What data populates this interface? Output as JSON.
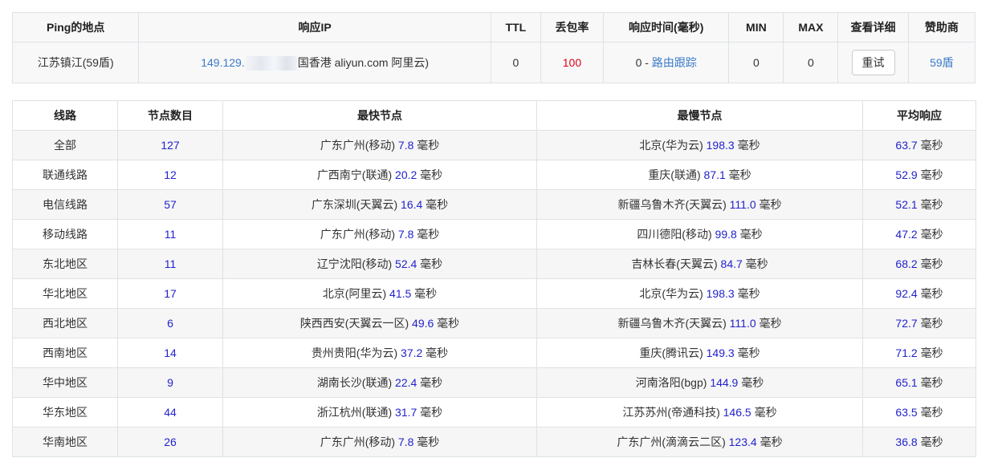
{
  "top_table": {
    "headers": [
      "Ping的地点",
      "响应IP",
      "TTL",
      "丢包率",
      "响应时间(毫秒)",
      "MIN",
      "MAX",
      "查看详细",
      "赞助商"
    ],
    "row": {
      "location": "江苏镇江(59盾)",
      "ip_prefix": "149.129.",
      "ip_suffix": "国香港 aliyun.com 阿里云)",
      "ttl": "0",
      "loss": "100",
      "resp_time": "0",
      "resp_sep": " - ",
      "trace_link": "路由跟踪",
      "min": "0",
      "max": "0",
      "retry_button": "重试",
      "sponsor": "59盾"
    }
  },
  "bottom_table": {
    "headers": [
      "线路",
      "节点数目",
      "最快节点",
      "最慢节点",
      "平均响应"
    ],
    "unit": "毫秒",
    "rows": [
      {
        "line": "全部",
        "count": "127",
        "fast_name": "广东广州(移动)",
        "fast_val": "7.8",
        "slow_name": "北京(华为云)",
        "slow_val": "198.3",
        "avg": "63.7"
      },
      {
        "line": "联通线路",
        "count": "12",
        "fast_name": "广西南宁(联通)",
        "fast_val": "20.2",
        "slow_name": "重庆(联通)",
        "slow_val": "87.1",
        "avg": "52.9"
      },
      {
        "line": "电信线路",
        "count": "57",
        "fast_name": "广东深圳(天翼云)",
        "fast_val": "16.4",
        "slow_name": "新疆乌鲁木齐(天翼云)",
        "slow_val": "111.0",
        "avg": "52.1"
      },
      {
        "line": "移动线路",
        "count": "11",
        "fast_name": "广东广州(移动)",
        "fast_val": "7.8",
        "slow_name": "四川德阳(移动)",
        "slow_val": "99.8",
        "avg": "47.2"
      },
      {
        "line": "东北地区",
        "count": "11",
        "fast_name": "辽宁沈阳(移动)",
        "fast_val": "52.4",
        "slow_name": "吉林长春(天翼云)",
        "slow_val": "84.7",
        "avg": "68.2"
      },
      {
        "line": "华北地区",
        "count": "17",
        "fast_name": "北京(阿里云)",
        "fast_val": "41.5",
        "slow_name": "北京(华为云)",
        "slow_val": "198.3",
        "avg": "92.4"
      },
      {
        "line": "西北地区",
        "count": "6",
        "fast_name": "陕西西安(天翼云一区)",
        "fast_val": "49.6",
        "slow_name": "新疆乌鲁木齐(天翼云)",
        "slow_val": "111.0",
        "avg": "72.7"
      },
      {
        "line": "西南地区",
        "count": "14",
        "fast_name": "贵州贵阳(华为云)",
        "fast_val": "37.2",
        "slow_name": "重庆(腾讯云)",
        "slow_val": "149.3",
        "avg": "71.2"
      },
      {
        "line": "华中地区",
        "count": "9",
        "fast_name": "湖南长沙(联通)",
        "fast_val": "22.4",
        "slow_name": "河南洛阳(bgp)",
        "slow_val": "144.9",
        "avg": "65.1"
      },
      {
        "line": "华东地区",
        "count": "44",
        "fast_name": "浙江杭州(联通)",
        "fast_val": "31.7",
        "slow_name": "江苏苏州(帝通科技)",
        "slow_val": "146.5",
        "avg": "63.5"
      },
      {
        "line": "华南地区",
        "count": "26",
        "fast_name": "广东广州(移动)",
        "fast_val": "7.8",
        "slow_name": "广东广州(滴滴云二区)",
        "slow_val": "123.4",
        "avg": "36.8"
      }
    ]
  }
}
